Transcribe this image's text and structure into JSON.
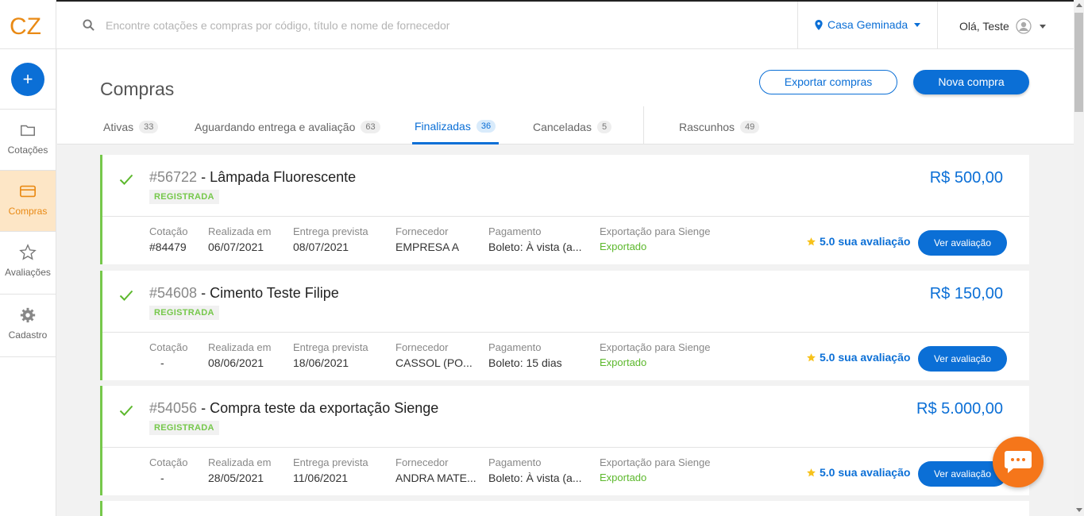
{
  "app": {
    "logo_text": "CZ"
  },
  "search": {
    "placeholder": "Encontre cotações e compras por código, título e nome de fornecedor"
  },
  "header": {
    "location": "Casa Geminada",
    "greeting": "Olá, Teste"
  },
  "sidebar": {
    "add_label": "+",
    "items": [
      {
        "label": "Cotações",
        "icon": "folder-icon",
        "active": false
      },
      {
        "label": "Compras",
        "icon": "card-icon",
        "active": true
      },
      {
        "label": "Avaliações",
        "icon": "star-icon",
        "active": false
      },
      {
        "label": "Cadastro",
        "icon": "gear-icon",
        "active": false
      }
    ]
  },
  "page": {
    "title": "Compras",
    "export_label": "Exportar compras",
    "new_label": "Nova compra"
  },
  "tabs": [
    {
      "label": "Ativas",
      "count": "33",
      "active": false
    },
    {
      "label": "Aguardando entrega e avaliação",
      "count": "63",
      "active": false
    },
    {
      "label": "Finalizadas",
      "count": "36",
      "active": true
    },
    {
      "label": "Canceladas",
      "count": "5",
      "active": false
    },
    {
      "label": "Rascunhos",
      "count": "49",
      "active": false
    }
  ],
  "field_labels": {
    "cotacao": "Cotação",
    "realizada": "Realizada em",
    "entrega": "Entrega prevista",
    "fornecedor": "Fornecedor",
    "pagamento": "Pagamento",
    "exportacao": "Exportação para Sienge"
  },
  "purchases": [
    {
      "number": "#56722",
      "title": " - Lâmpada Fluorescente",
      "status": "REGISTRADA",
      "price": "R$ 500,00",
      "cotacao": "#84479",
      "realizada": "06/07/2021",
      "entrega": "08/07/2021",
      "fornecedor": "EMPRESA A",
      "pagamento": "Boleto: À vista (a...",
      "exportacao": "Exportado",
      "rating": "5.0 sua avaliação",
      "action": "Ver avaliação"
    },
    {
      "number": "#54608",
      "title": " - Cimento Teste Filipe",
      "status": "REGISTRADA",
      "price": "R$ 150,00",
      "cotacao": "-",
      "realizada": "08/06/2021",
      "entrega": "18/06/2021",
      "fornecedor": "CASSOL (PO...",
      "pagamento": "Boleto: 15 dias",
      "exportacao": "Exportado",
      "rating": "5.0 sua avaliação",
      "action": "Ver avaliação"
    },
    {
      "number": "#54056",
      "title": " - Compra teste da exportação Sienge",
      "status": "REGISTRADA",
      "price": "R$ 5.000,00",
      "cotacao": "-",
      "realizada": "28/05/2021",
      "entrega": "11/06/2021",
      "fornecedor": "ANDRA MATE...",
      "pagamento": "Boleto: À vista (a...",
      "exportacao": "Exportado",
      "rating": "5.0 sua avaliação",
      "action": "Ver avaliação"
    }
  ],
  "colors": {
    "primary": "#0b6fd6",
    "accent": "#e98a15",
    "success": "#76c84b",
    "chat": "#f5761a"
  }
}
